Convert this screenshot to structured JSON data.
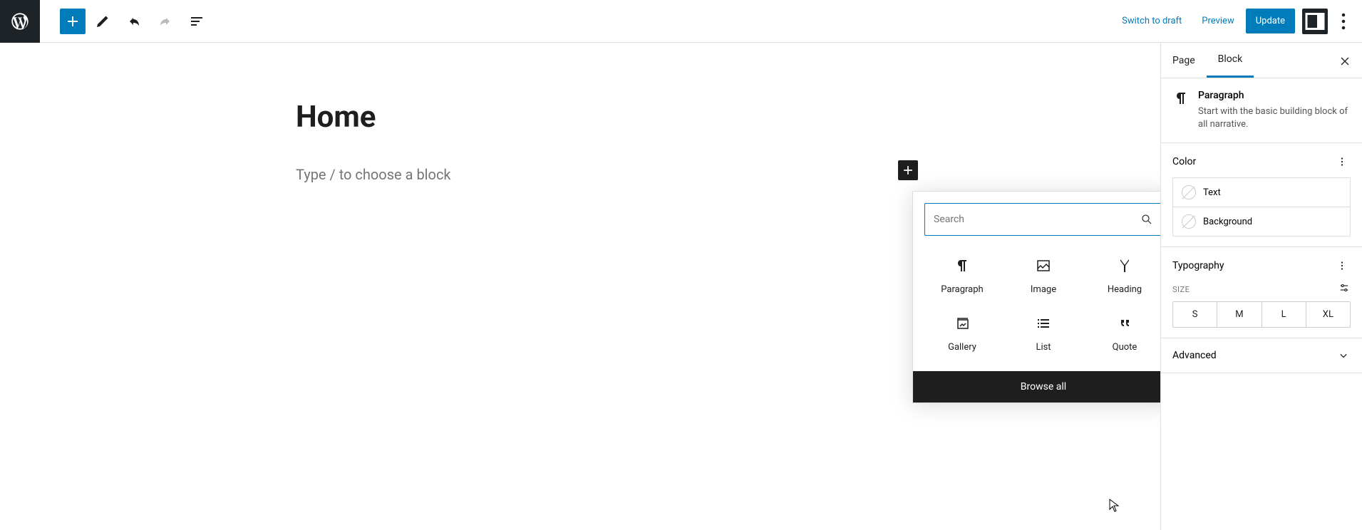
{
  "topbar": {
    "switch_draft": "Switch to draft",
    "preview": "Preview",
    "update": "Update"
  },
  "page": {
    "title": "Home",
    "placeholder": "Type / to choose a block"
  },
  "inserter": {
    "search_placeholder": "Search",
    "blocks": {
      "paragraph": "Paragraph",
      "image": "Image",
      "heading": "Heading",
      "gallery": "Gallery",
      "list": "List",
      "quote": "Quote"
    },
    "browse_all": "Browse all"
  },
  "sidebar": {
    "tabs": {
      "page": "Page",
      "block": "Block"
    },
    "block": {
      "title": "Paragraph",
      "description": "Start with the basic building block of all narrative."
    },
    "color": {
      "heading": "Color",
      "text": "Text",
      "background": "Background"
    },
    "typography": {
      "heading": "Typography",
      "size_label": "Size",
      "sizes": {
        "s": "S",
        "m": "M",
        "l": "L",
        "xl": "XL"
      }
    },
    "advanced": "Advanced"
  }
}
